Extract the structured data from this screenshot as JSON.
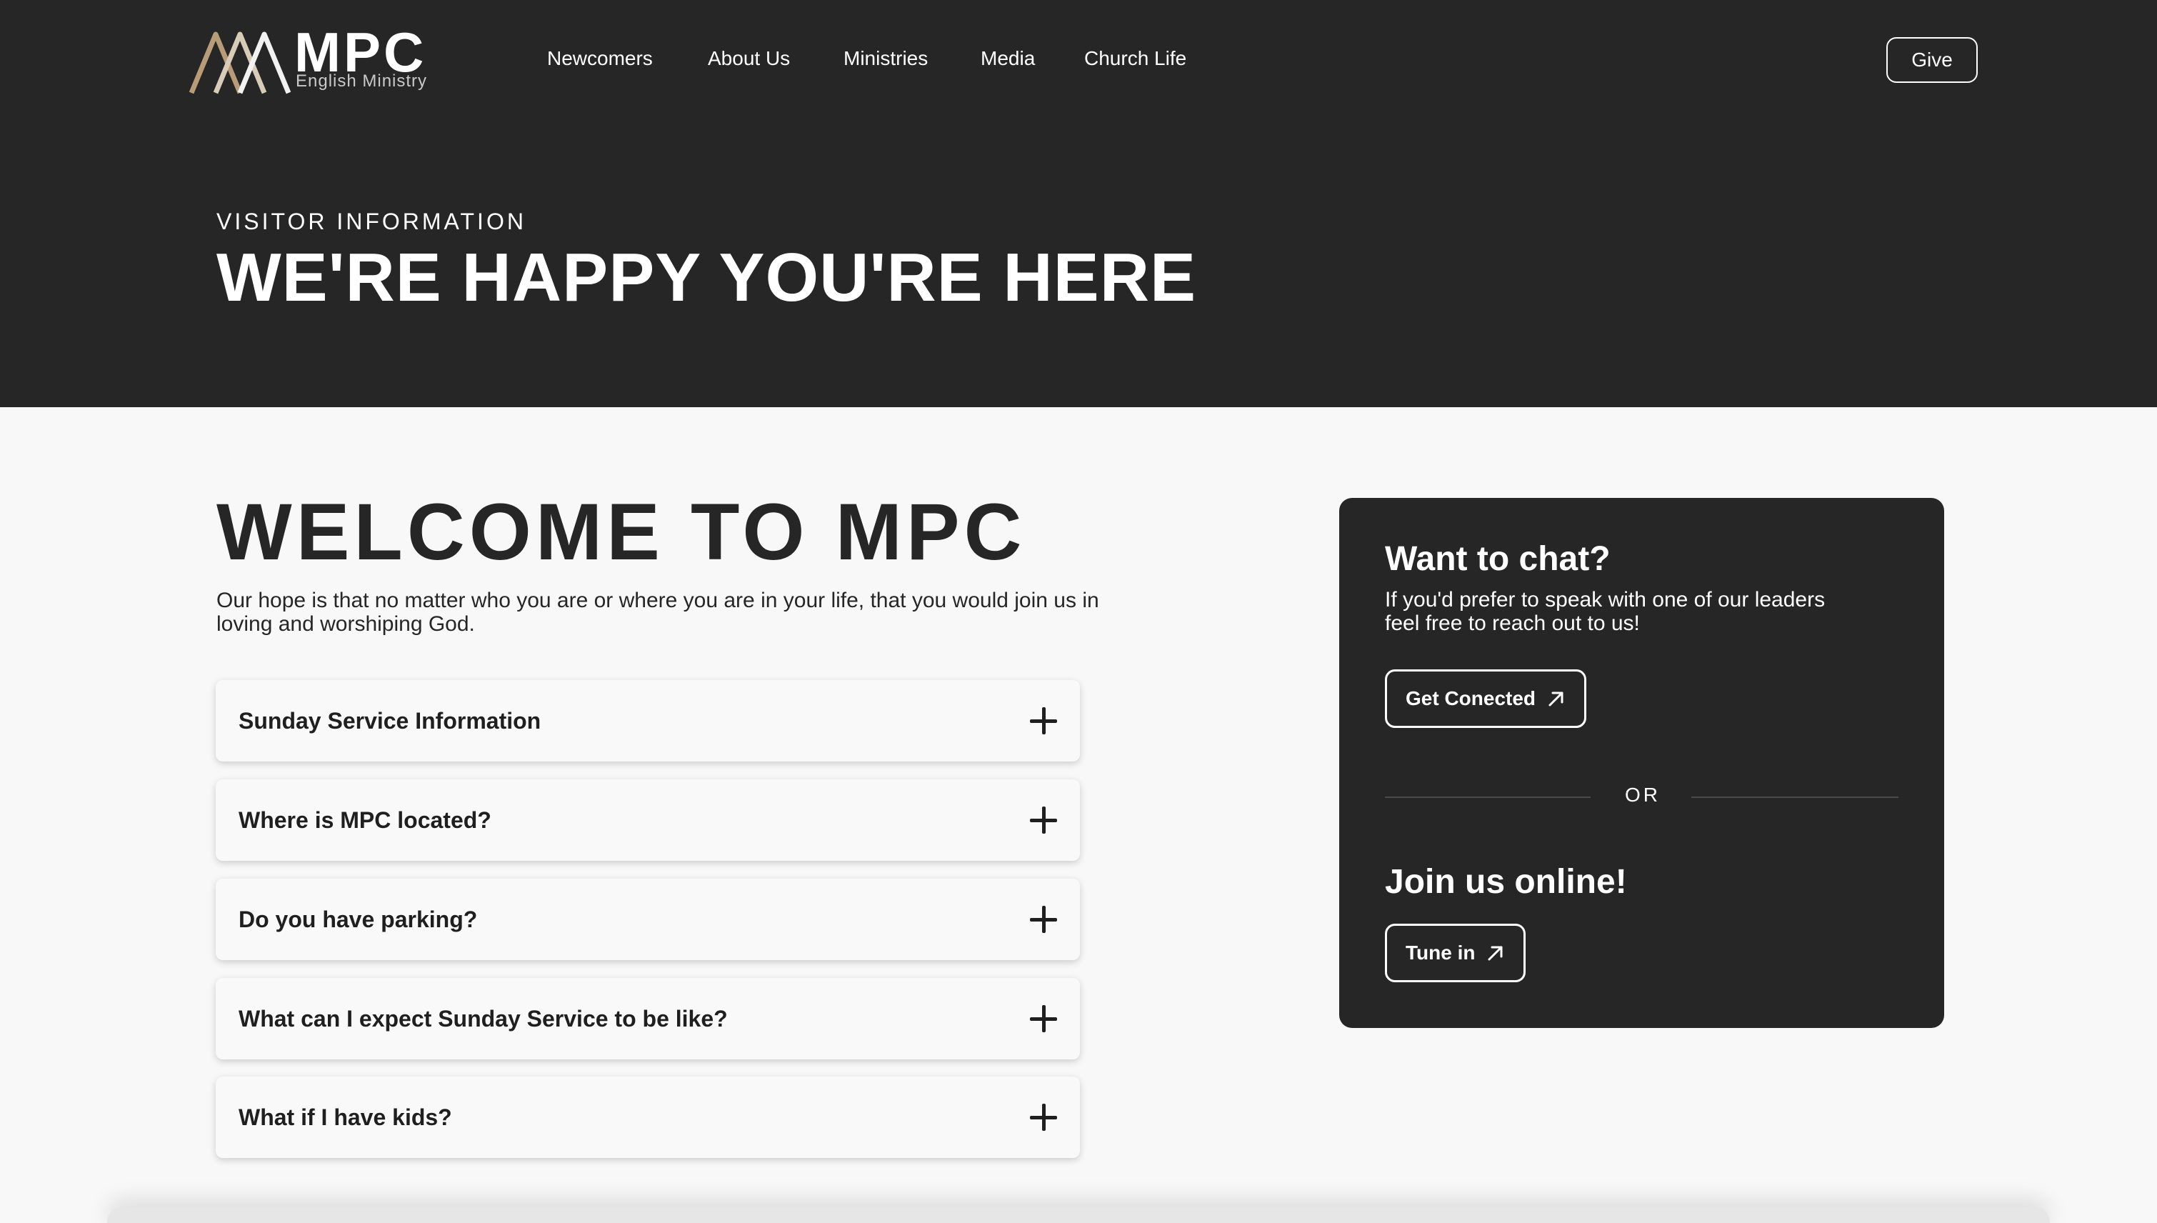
{
  "header": {
    "logo": {
      "main": "MPC",
      "sub": "English Ministry"
    },
    "nav": [
      {
        "label": "Newcomers"
      },
      {
        "label": "About Us"
      },
      {
        "label": "Ministries"
      },
      {
        "label": "Media"
      },
      {
        "label": "Church Life"
      }
    ],
    "give_label": "Give"
  },
  "hero": {
    "eyebrow": "VISITOR INFORMATION",
    "title": "WE'RE HAPPY YOU'RE HERE"
  },
  "welcome": {
    "title": "WELCOME TO MPC",
    "text": "Our hope is that no matter who you are or where you are in your life, that you would join us in loving and worshiping God."
  },
  "faq": [
    {
      "question": "Sunday Service Information"
    },
    {
      "question": "Where is MPC located?"
    },
    {
      "question": "Do you have parking?"
    },
    {
      "question": "What can I expect Sunday Service to be like?"
    },
    {
      "question": "What if I have kids?"
    }
  ],
  "card": {
    "chat_heading": "Want to chat?",
    "chat_text": "If you'd prefer to speak with one of our leaders feel free to reach out to us!",
    "connect_label": "Get Conected",
    "or_label": "OR",
    "online_heading": "Join us online!",
    "tune_label": "Tune in"
  },
  "colors": {
    "dark": "#262626",
    "light_bg": "#f8f8f8",
    "logo_gold": "#b89c78",
    "white": "#ffffff"
  },
  "icons": {
    "faq_toggle": "plus-icon",
    "external": "arrow-up-right-icon"
  }
}
